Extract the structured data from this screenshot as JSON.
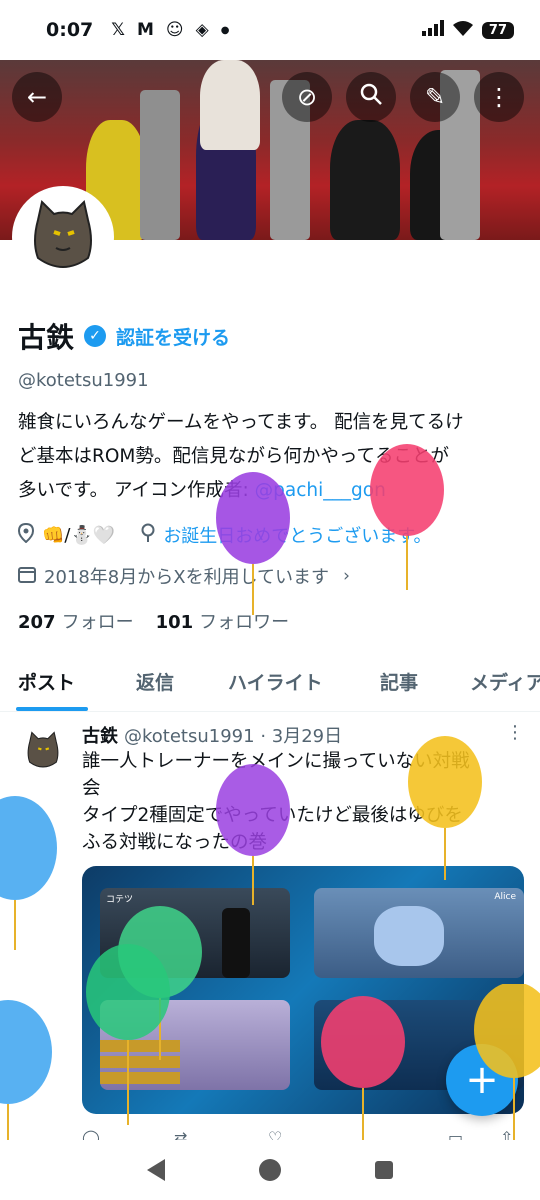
{
  "status_bar": {
    "time": "0:07",
    "icons": [
      "x-logo-icon",
      "gmail-icon",
      "cat-app-icon",
      "diamond-app-icon",
      "dot-icon"
    ],
    "battery": "77"
  },
  "profile": {
    "name": "古鉄",
    "verify_link": "認証を受ける",
    "handle": "@kotetsu1991",
    "bio_lines": [
      "雑食にいろんなゲームをやってます。 配信を見てるけ",
      "ど基本はROM勢。配信見ながら何かやってることが",
      "多いです。 アイコン作成者: "
    ],
    "bio_mention": "@pachi___gon",
    "location": "👊/⛄🤍",
    "website": "お誕生日おめでとうございます。",
    "joined": "2018年8月からXを利用しています",
    "following_count": "207",
    "following_label": "フォロー",
    "followers_count": "101",
    "followers_label": "フォロワー"
  },
  "tabs": [
    "ポスト",
    "返信",
    "ハイライト",
    "記事",
    "メディア"
  ],
  "post": {
    "name": "古鉄",
    "handle": "@kotetsu1991",
    "date": "· 3月29日",
    "text_lines": [
      "誰一人トレーナーをメインに撮っていない対戦",
      "会",
      "タイプ2種固定でやっていたけど最後はゆびを",
      "ふる対戦になったの巻"
    ],
    "media_labels": [
      "コテツ",
      "Alice"
    ]
  },
  "fab_label": "+"
}
